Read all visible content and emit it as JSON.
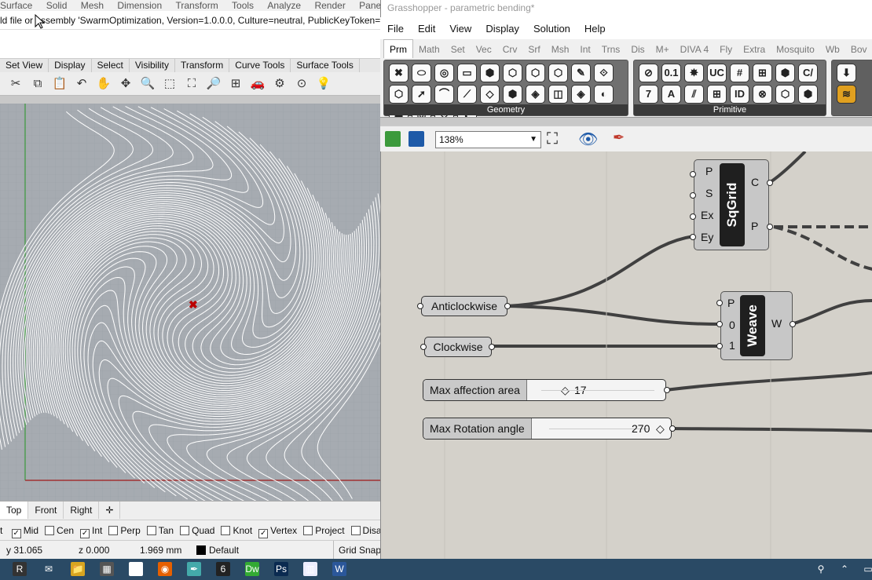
{
  "rhino": {
    "menu": [
      "Surface",
      "Solid",
      "Mesh",
      "Dimension",
      "Transform",
      "Tools",
      "Analyze",
      "Render",
      "Panels"
    ],
    "command_line": "ld file or assembly 'SwarmOptimization, Version=1.0.0.0, Culture=neutral, PublicKeyToken=nu",
    "toolbar_tabs": [
      "Set View",
      "Display",
      "Select",
      "Visibility",
      "Transform",
      "Curve Tools",
      "Surface Tools"
    ],
    "view_tabs": [
      "Top",
      "Front",
      "Right"
    ],
    "view_tab_add": "✛",
    "osnaps": [
      {
        "label": "Mid",
        "checked": true
      },
      {
        "label": "Cen",
        "checked": false
      },
      {
        "label": "Int",
        "checked": true
      },
      {
        "label": "Perp",
        "checked": false
      },
      {
        "label": "Tan",
        "checked": false
      },
      {
        "label": "Quad",
        "checked": false
      },
      {
        "label": "Knot",
        "checked": false
      },
      {
        "label": "Vertex",
        "checked": true
      },
      {
        "label": "Project",
        "checked": false
      },
      {
        "label": "Disa",
        "checked": false
      }
    ],
    "osnap_lead": "t",
    "status": {
      "y": "y 31.065",
      "z": "z 0.000",
      "dist": "1.969 mm",
      "layer": "Default",
      "grid": "Grid Snap"
    }
  },
  "gh": {
    "title": "Grasshopper - parametric bending*",
    "menu": [
      "File",
      "Edit",
      "View",
      "Display",
      "Solution",
      "Help"
    ],
    "tabs": [
      "Prm",
      "Math",
      "Set",
      "Vec",
      "Crv",
      "Srf",
      "Msh",
      "Int",
      "Trns",
      "Dis",
      "M+",
      "DIVA 4",
      "Fly",
      "Extra",
      "Mosquito",
      "Wb",
      "Bov"
    ],
    "ribbon_groups": [
      "Geometry",
      "Primitive"
    ],
    "geometry_icons": [
      "✖",
      "⬭",
      "◎",
      "▭",
      "⬢",
      "⬡",
      "⬡",
      "⬡",
      "✎",
      "⟐",
      "⬡",
      "➚",
      "⌒",
      "⟋",
      "◇",
      "⬢",
      "◈",
      "◫",
      "◈",
      "◐",
      "⬢",
      "◎",
      "⟐",
      "◐"
    ],
    "primitive_icons": [
      "⊘",
      "0.1",
      "✸",
      "UC",
      "#",
      "⊞",
      "⬢",
      "C/",
      "7",
      "A",
      "⫽",
      "⊞",
      "ID",
      "⊗",
      "⬡",
      "⬢"
    ],
    "zoom": "138%",
    "sqgrid": {
      "name": "SqGrid",
      "inputs": [
        "P",
        "S",
        "Ex",
        "Ey"
      ],
      "outputs": [
        "C",
        "P"
      ]
    },
    "weave": {
      "name": "Weave",
      "inputs": [
        "P",
        "0",
        "1"
      ],
      "outputs": [
        "W"
      ]
    },
    "panels": [
      "Anticlockwise",
      "Clockwise"
    ],
    "sliders": [
      {
        "name": "Max affection area",
        "value": "17",
        "marker": "◇"
      },
      {
        "name": "Max Rotation angle",
        "value": "270",
        "marker": "◇"
      }
    ]
  },
  "taskbar": {
    "icons": [
      "rhino-icon",
      "mail-icon",
      "folder-icon",
      "calculator-icon",
      "document-icon",
      "firefox-icon",
      "pen-icon",
      "rhino6-icon",
      "dreamweaver-icon",
      "photoshop-icon",
      "notes-icon",
      "word-icon"
    ],
    "labels": [
      "R",
      "✉",
      "📁",
      "▦",
      "▤",
      "◉",
      "✒",
      "6",
      "Dw",
      "Ps",
      "▥",
      "W"
    ],
    "tray": [
      "⚲",
      "⌃",
      "▭"
    ]
  },
  "colors": {
    "gh_canvas": "#d4d1ca",
    "viewport": "#a6abb1",
    "taskbar": "#2a4a65"
  }
}
